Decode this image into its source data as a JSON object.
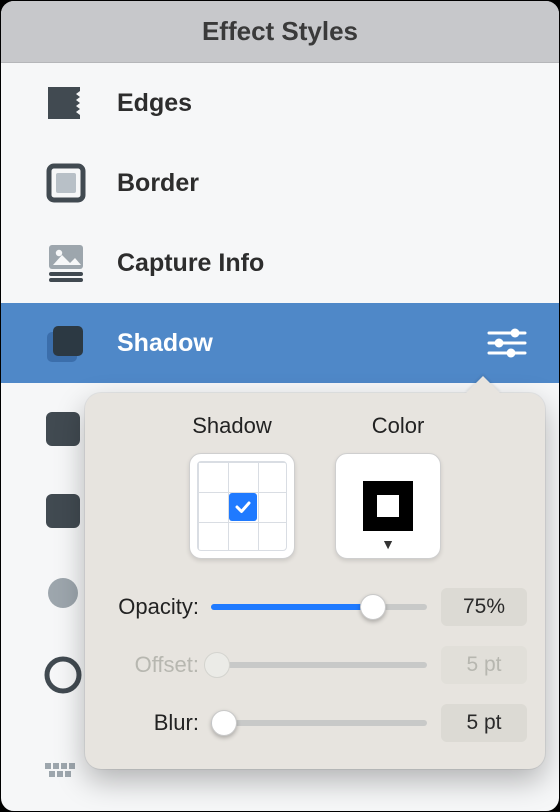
{
  "title": "Effect Styles",
  "items": [
    {
      "id": "edges",
      "label": "Edges",
      "icon": "edges-icon"
    },
    {
      "id": "border",
      "label": "Border",
      "icon": "border-icon"
    },
    {
      "id": "capture",
      "label": "Capture Info",
      "icon": "capture-info-icon"
    },
    {
      "id": "shadow",
      "label": "Shadow",
      "icon": "shadow-icon",
      "selected": true
    }
  ],
  "shadow_panel": {
    "heading_position": "Shadow",
    "heading_color": "Color",
    "opacity": {
      "label": "Opacity:",
      "value_text": "75%",
      "percent": 75,
      "enabled": true
    },
    "offset": {
      "label": "Offset:",
      "value_text": "5 pt",
      "percent": 3,
      "enabled": false
    },
    "blur": {
      "label": "Blur:",
      "value_text": "5 pt",
      "percent": 6,
      "enabled": true
    }
  },
  "colors": {
    "accent": "#4f88c8",
    "slider_blue": "#1f7aff"
  }
}
